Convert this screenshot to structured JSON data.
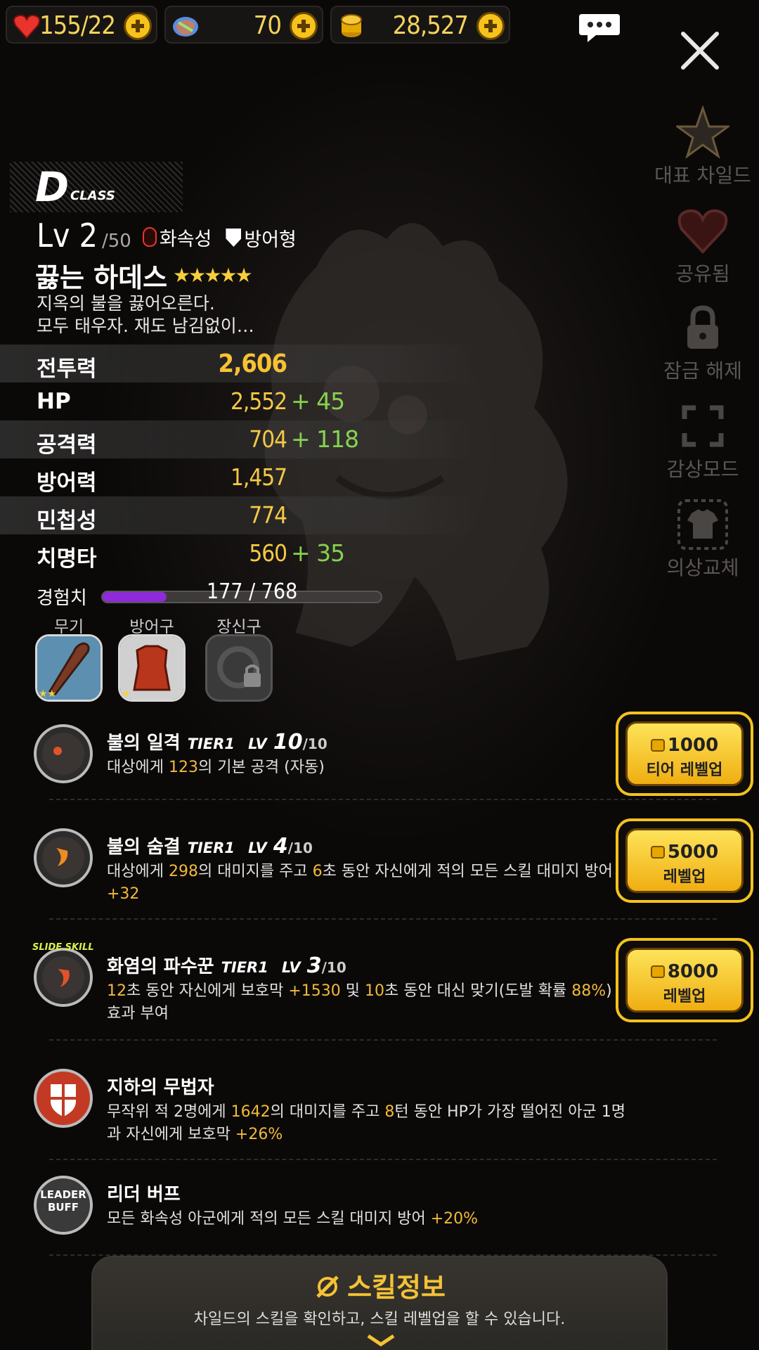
{
  "resources": {
    "hearts": "155/22",
    "gems": "70",
    "gold": "28,527"
  },
  "right_menu": [
    {
      "label": "대표 차일드",
      "icon": "star-icon"
    },
    {
      "label": "공유됨",
      "icon": "heart-icon"
    },
    {
      "label": "잠금 해제",
      "icon": "lock-icon"
    },
    {
      "label": "감상모드",
      "icon": "fullscreen-icon"
    },
    {
      "label": "의상교체",
      "icon": "shirt-icon"
    }
  ],
  "character": {
    "class_letter": "D",
    "class_word": "CLASS",
    "level": "Lv 2",
    "max_level": "/50",
    "element": "화속성",
    "type": "방어형",
    "name": "끓는 하데스",
    "stars": "★★★★★",
    "description_lines": [
      "지옥의 불을 끓어오른다.",
      "모두 태우자. 재도 남김없이…"
    ]
  },
  "stats": [
    {
      "label": "전투력",
      "value": "2,606",
      "bonus": ""
    },
    {
      "label": "HP",
      "value": "2,552",
      "bonus": "+ 45"
    },
    {
      "label": "공격력",
      "value": "704",
      "bonus": "+ 118"
    },
    {
      "label": "방어력",
      "value": "1,457",
      "bonus": ""
    },
    {
      "label": "민첩성",
      "value": "774",
      "bonus": ""
    },
    {
      "label": "치명타",
      "value": "560",
      "bonus": "+ 35"
    }
  ],
  "experience": {
    "label": "경험치",
    "text": "177 / 768",
    "fraction": 0.23
  },
  "equipment": [
    {
      "label": "무기"
    },
    {
      "label": "방어구"
    },
    {
      "label": "장신구"
    }
  ],
  "skills": [
    {
      "name": "불의 일격",
      "tier": "TIER1",
      "lv_label": "LV",
      "lv": "10",
      "lv_max": "/10",
      "desc": [
        "대상에게 ",
        "123",
        "의 기본 공격 (자동)"
      ],
      "cost": "1000",
      "button": "티어 레벨업"
    },
    {
      "name": "불의 숨결",
      "tier": "TIER1",
      "lv_label": "LV",
      "lv": "4",
      "lv_max": "/10",
      "desc": [
        "대상에게 ",
        "298",
        "의 대미지를 주고 ",
        "6",
        "초 동안 자신에게 적의 모든 스킬 대미지 방어 ",
        "+32"
      ],
      "cost": "5000",
      "button": "레벨업"
    },
    {
      "name": "화염의 파수꾼",
      "tier": "TIER1",
      "lv_label": "LV",
      "lv": "3",
      "lv_max": "/10",
      "desc": [
        "12",
        "초 동안 자신에게 보호막 ",
        "+1530",
        " 및 ",
        "10",
        "초 동안 대신 맞기(도발 확률 ",
        "88%",
        ") 효과 부여"
      ],
      "cost": "8000",
      "button": "레벨업",
      "badge": "SLIDE SKILL"
    },
    {
      "name": "지하의 무법자",
      "desc": [
        "무작위 적 2명에게 ",
        "1642",
        "의 대미지를 주고 ",
        "8",
        "턴 동안 HP가 가장 떨어진 아군 1명과 자신에게 보호막 ",
        "+26%"
      ]
    },
    {
      "name": "리더 버프",
      "desc": [
        "모든 화속성 아군에게 적의 모든 스킬 대미지 방어 ",
        "+20%"
      ],
      "badge": "LEADER BUFF"
    }
  ],
  "bottom": {
    "title": "스킬정보",
    "desc": "차일드의 스킬을 확인하고, 스킬 레벨업을 할 수 있습니다."
  }
}
